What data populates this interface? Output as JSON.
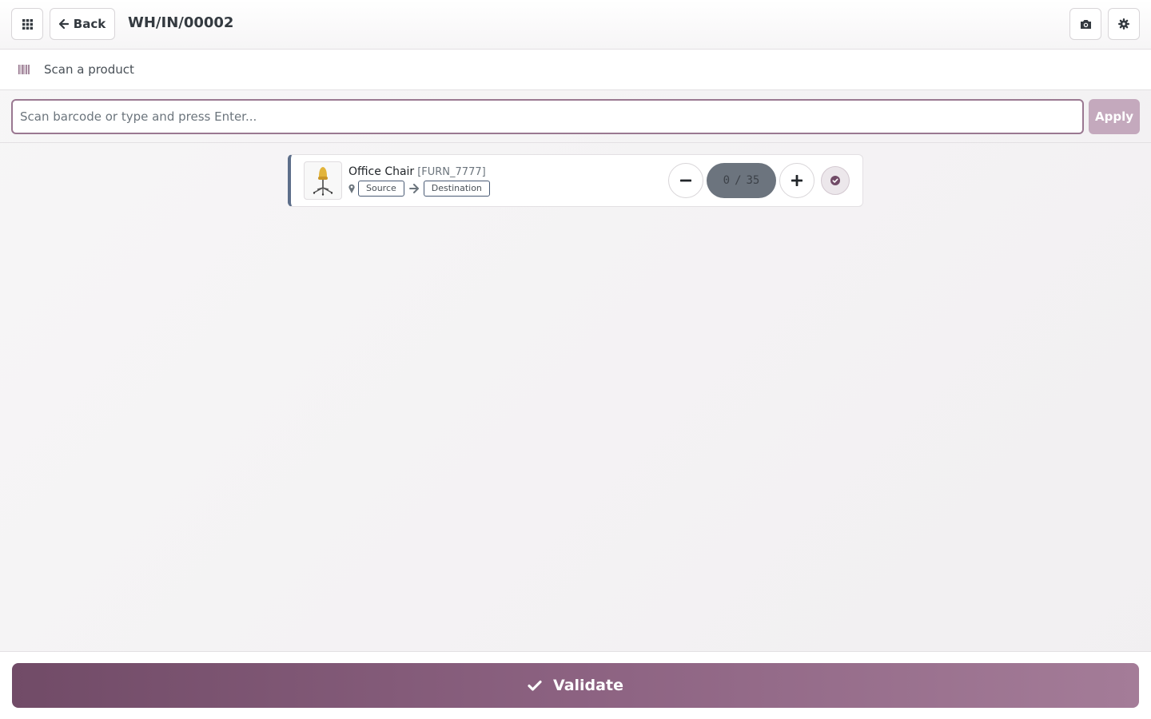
{
  "header": {
    "back_label": "Back",
    "title": "WH/IN/00002",
    "apps_icon": "grid-icon",
    "camera_icon": "camera-icon",
    "settings_icon": "gear-icon"
  },
  "instruction": {
    "text": "Scan a product",
    "icon": "barcode-icon"
  },
  "scan": {
    "placeholder": "Scan barcode or type and press Enter...",
    "value": "",
    "apply_label": "Apply"
  },
  "lines": [
    {
      "product_name": "Office Chair",
      "product_code": "[FURN_7777]",
      "source_label": "Source",
      "destination_label": "Destination",
      "qty_done": "0",
      "qty_separator": "/",
      "qty_demand": "35",
      "status_color": "#5d6e8a"
    }
  ],
  "footer": {
    "validate_label": "Validate",
    "color": "#714b67"
  }
}
